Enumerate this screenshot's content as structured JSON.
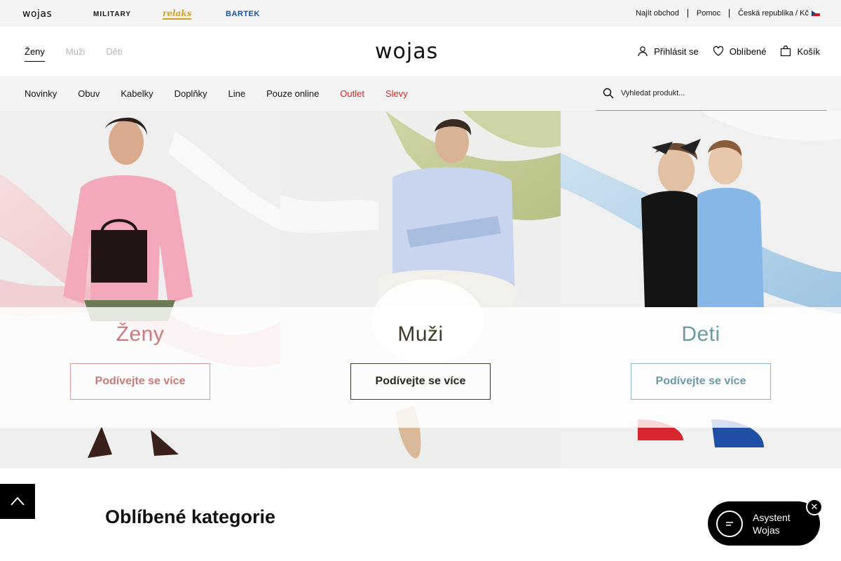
{
  "topbar": {
    "brands": [
      "wojas",
      "MILITARY",
      "relaks",
      "BARTEK"
    ],
    "links": [
      "Najít obchod",
      "Pomoc",
      "Česká republika / Kč"
    ]
  },
  "header": {
    "gender_tabs": [
      "Ženy",
      "Muži",
      "Děti"
    ],
    "active_tab": "Ženy",
    "logo": "wojas",
    "login": "Přihlásit se",
    "favorites": "Oblíbené",
    "cart": "Košík"
  },
  "nav": {
    "items": [
      "Novinky",
      "Obuv",
      "Kabelky",
      "Doplňky",
      "Line",
      "Pouze online",
      "Outlet",
      "Slevy"
    ],
    "search_placeholder": "Vyhledat produkt..."
  },
  "hero": {
    "panels": [
      {
        "title": "Ženy",
        "button": "Podívejte se více"
      },
      {
        "title": "Muži",
        "button": "Podívejte se více"
      },
      {
        "title": "Deti",
        "button": "Podívejte se více"
      }
    ]
  },
  "section": {
    "title": "Oblíbené kategorie"
  },
  "assistant": {
    "line1": "Asystent",
    "line2": "Wojas"
  },
  "colors": {
    "accent_red": "#d22222",
    "women": "#c97a7a",
    "men": "#3f3a2a",
    "kids": "#6b9aa5"
  }
}
